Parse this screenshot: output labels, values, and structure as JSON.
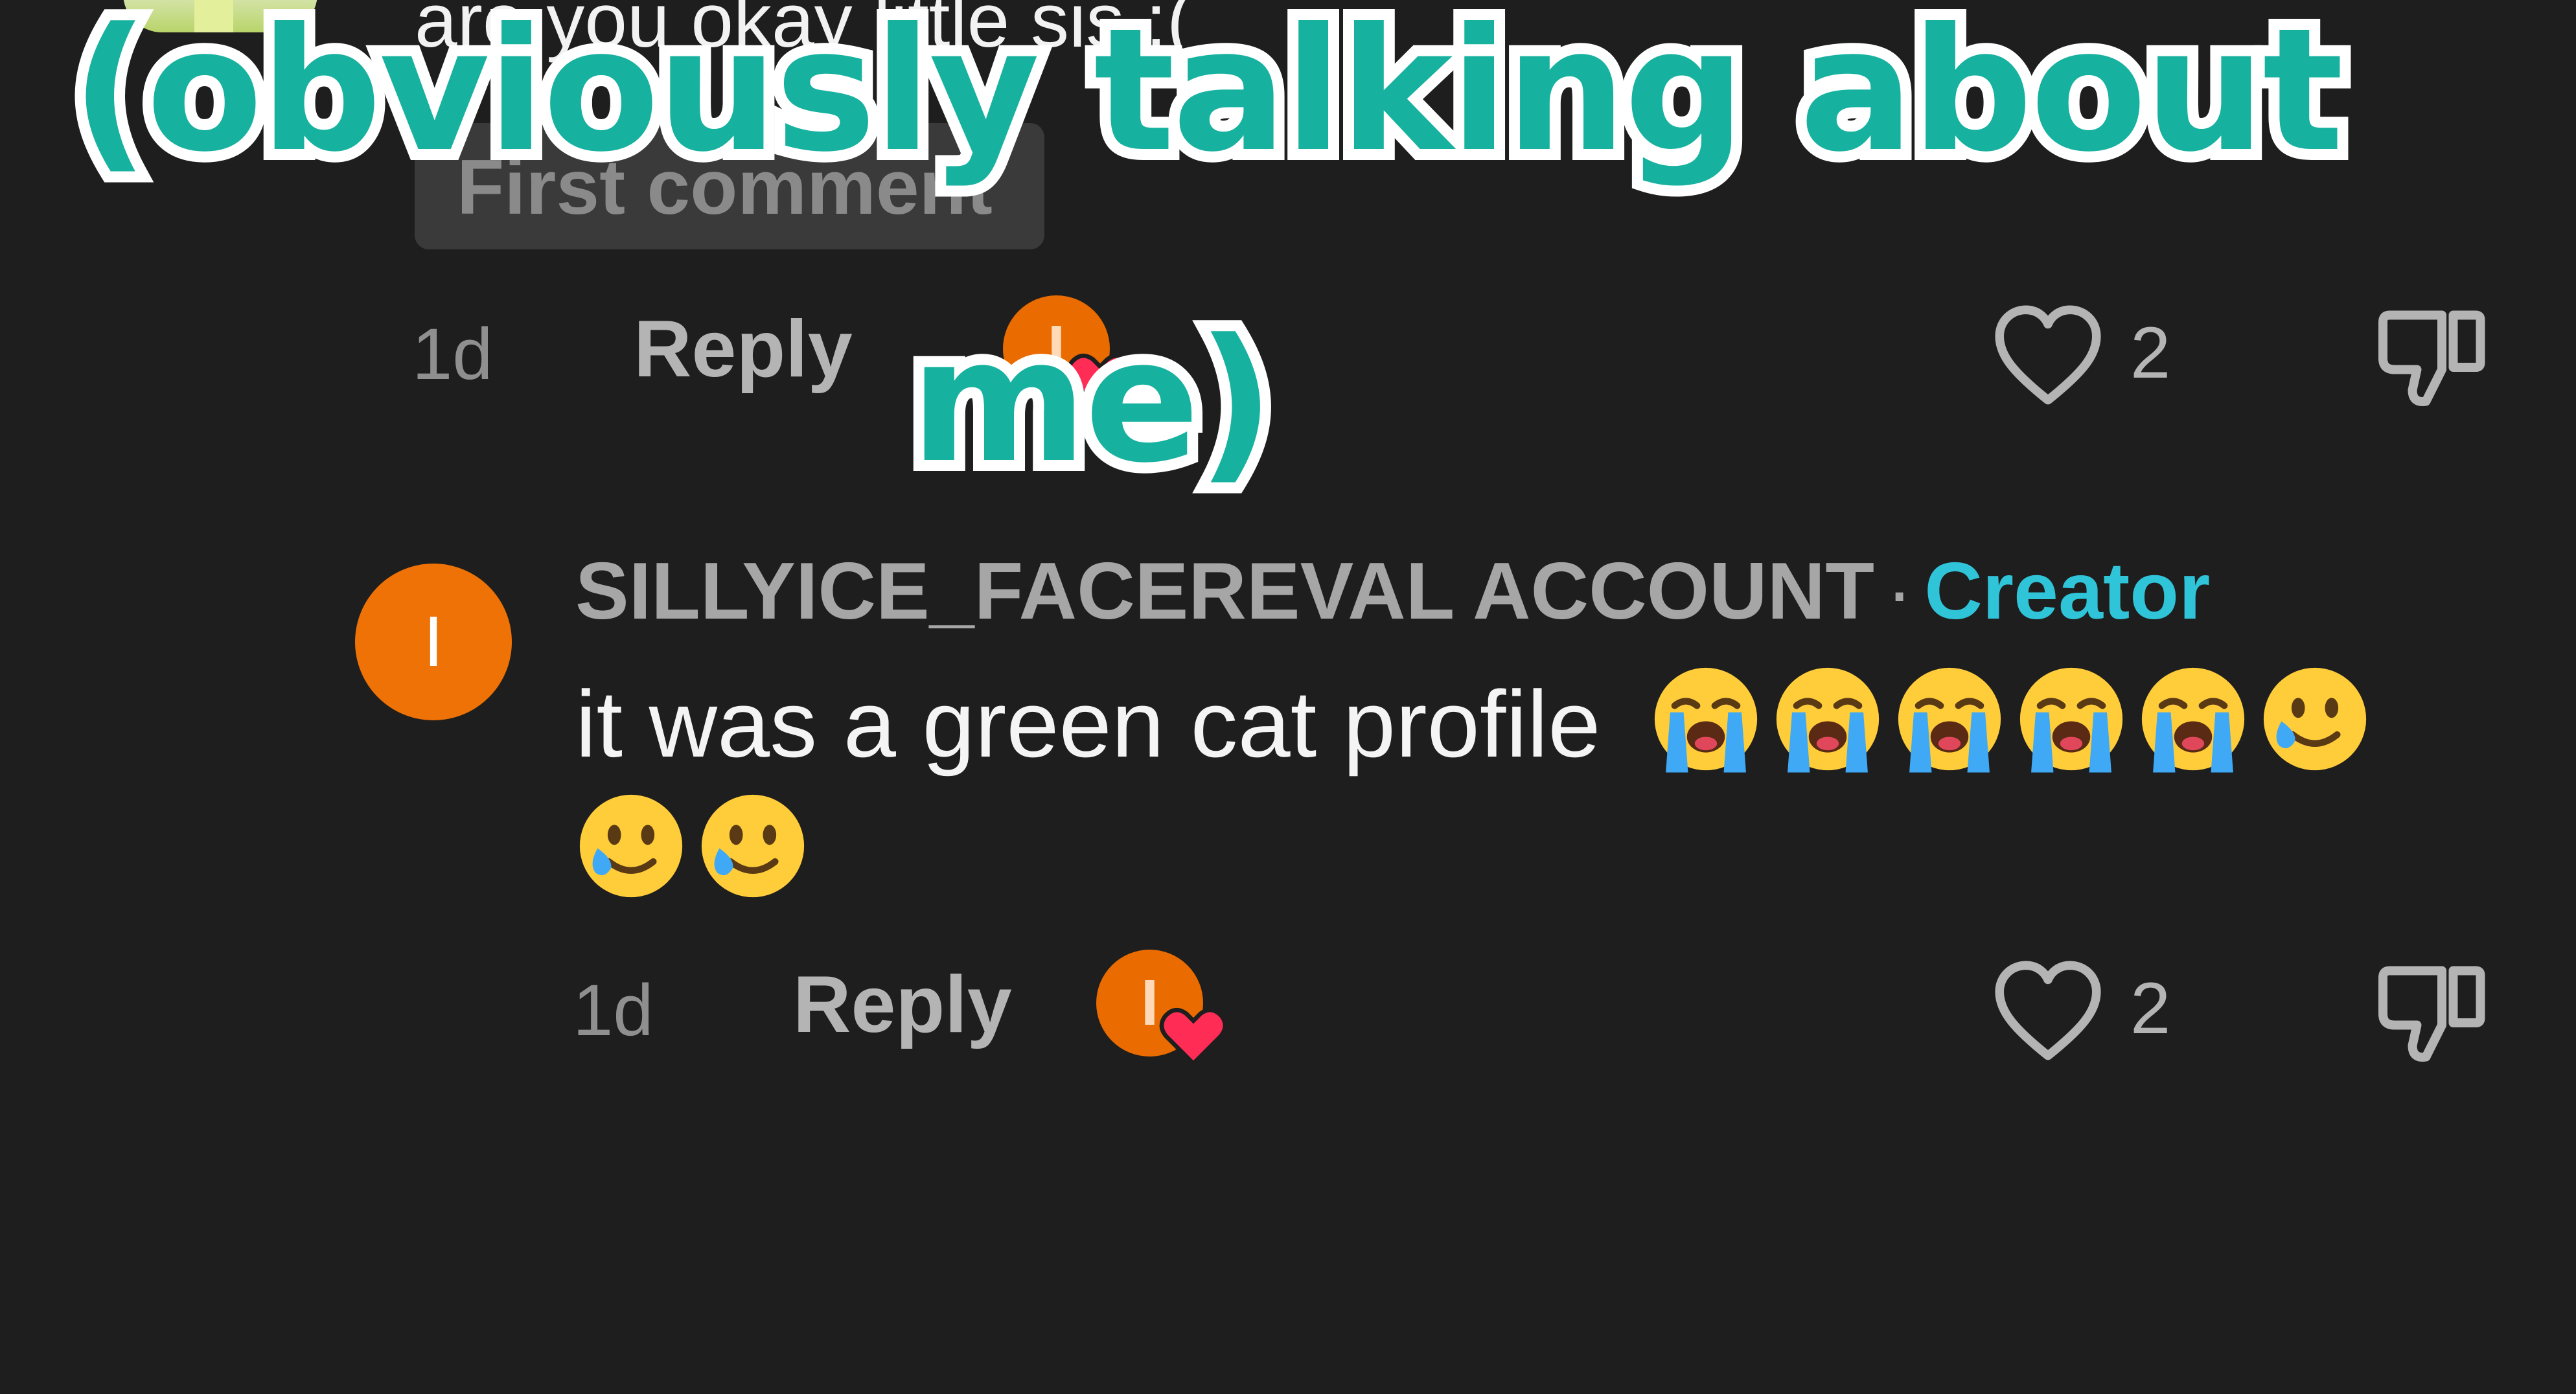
{
  "comment_top": {
    "text": "are you okay little sis :(",
    "badge": "First comment",
    "time": "1d",
    "reply_label": "Reply",
    "liked_by_initial": "I",
    "like_count": "2"
  },
  "overlay_caption": {
    "line1": "(obviously talking about",
    "line2": "me)"
  },
  "reply_comment": {
    "avatar_initial": "I",
    "username": "SILLYICE_FACEREVAL ACCOUNT",
    "separator": "·",
    "creator_label": "Creator",
    "text": "it was a green cat profile",
    "emojis": [
      "loudly-crying-face-emoji",
      "loudly-crying-face-emoji",
      "loudly-crying-face-emoji",
      "loudly-crying-face-emoji",
      "loudly-crying-face-emoji",
      "smiling-face-with-tear-emoji",
      "smiling-face-with-tear-emoji",
      "smiling-face-with-tear-emoji"
    ],
    "time": "1d",
    "reply_label": "Reply",
    "liked_by_initial": "I",
    "like_count": "2"
  },
  "colors": {
    "background": "#1e1e1e",
    "creator_accent": "#2fc4d8",
    "caption_fill": "#17b29f",
    "avatar_orange": "#ee7205",
    "heart_red": "#ff2d55"
  }
}
